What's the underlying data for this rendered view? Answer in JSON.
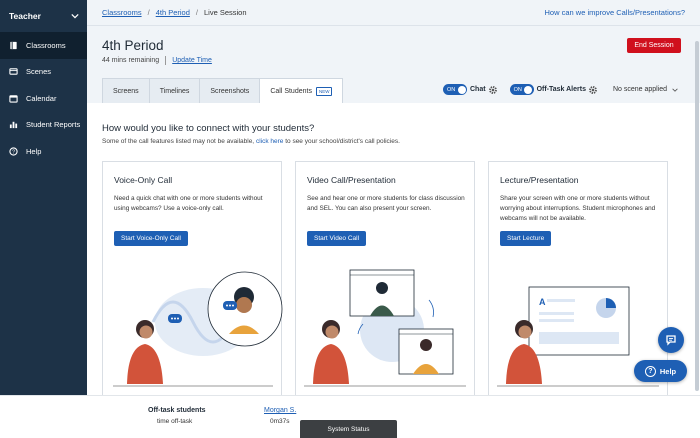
{
  "sidebar": {
    "role_label": "Teacher",
    "items": [
      {
        "label": "Classrooms",
        "icon": "book-icon"
      },
      {
        "label": "Scenes",
        "icon": "scenes-icon"
      },
      {
        "label": "Calendar",
        "icon": "calendar-icon"
      },
      {
        "label": "Student Reports",
        "icon": "bar-chart-icon"
      },
      {
        "label": "Help",
        "icon": "help-icon"
      }
    ]
  },
  "breadcrumb": {
    "classrooms": "Classrooms",
    "period": "4th Period",
    "current": "Live Session"
  },
  "topbar": {
    "improve_link": "How can we improve Calls/Presentations?"
  },
  "header": {
    "title": "4th Period",
    "remaining": "44 mins remaining",
    "update_time": "Update Time",
    "end_session": "End Session"
  },
  "tabs": [
    {
      "label": "Screens"
    },
    {
      "label": "Timelines"
    },
    {
      "label": "Screenshots"
    },
    {
      "label": "Call Students",
      "badge": "NEW"
    }
  ],
  "toggles": {
    "chat": {
      "state": "ON",
      "label": "Chat"
    },
    "off_task": {
      "state": "ON",
      "label": "Off-Task Alerts"
    },
    "scene": "No scene applied"
  },
  "main": {
    "question": "How would you like to connect with your students?",
    "note_before": "Some of the call features listed may not be available,",
    "note_link": "click here",
    "note_after": "to see your school/district's call policies."
  },
  "cards": [
    {
      "title": "Voice-Only Call",
      "desc": "Need a quick chat with one or more students without using webcams? Use a voice-only call.",
      "button": "Start Voice-Only Call"
    },
    {
      "title": "Video Call/Presentation",
      "desc": "See and hear one or more students for class discussion and SEL. You can also present your screen.",
      "button": "Start Video Call"
    },
    {
      "title": "Lecture/Presentation",
      "desc": "Share your screen with one or more students without worrying about interruptions. Student microphones and webcams will not be available.",
      "button": "Start Lecture"
    }
  ],
  "floating": {
    "help": "Help"
  },
  "bottom": {
    "off_task_title": "Off-task students",
    "off_task_sub": "time off-task",
    "student_name": "Morgan S.",
    "student_time": "0m37s",
    "system_status": "System Status"
  },
  "colors": {
    "sidebar_bg": "#1d3247",
    "accent": "#1e5fb4",
    "danger": "#d0101d"
  }
}
